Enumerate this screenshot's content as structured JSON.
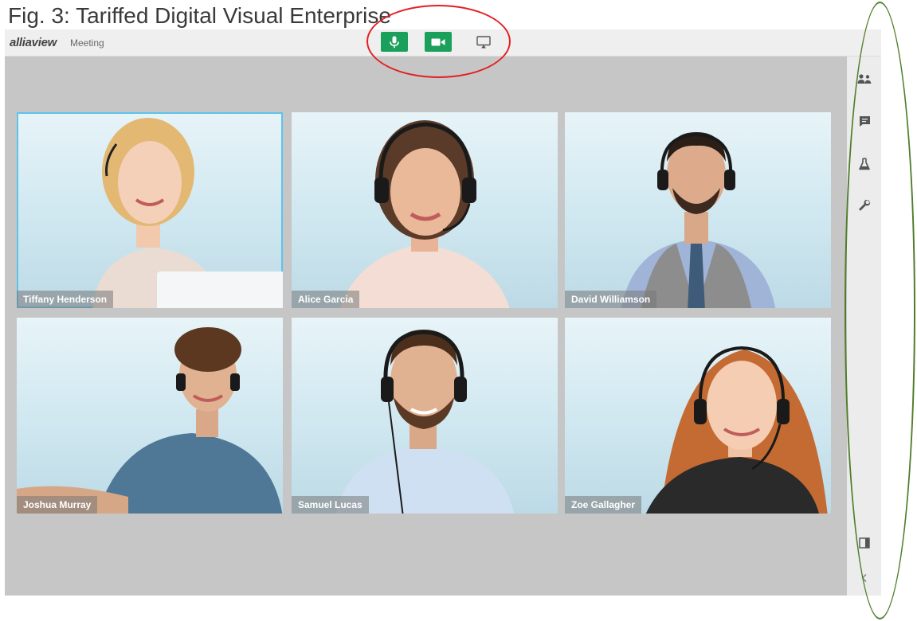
{
  "caption": "Fig. 3: Tariffed Digital Visual Enterprise",
  "app": {
    "brand": "alliaview",
    "subtitle": "Meeting"
  },
  "toolbar": {
    "buttons": [
      {
        "icon": "microphone-icon",
        "active": true
      },
      {
        "icon": "video-camera-icon",
        "active": true
      },
      {
        "icon": "screen-share-icon",
        "active": false
      }
    ]
  },
  "participants": [
    {
      "name": "Tiffany Henderson",
      "active": true
    },
    {
      "name": "Alice Garcia",
      "active": false
    },
    {
      "name": "David Williamson",
      "active": false
    },
    {
      "name": "Joshua Murray",
      "active": false
    },
    {
      "name": "Samuel Lucas",
      "active": false
    },
    {
      "name": "Zoe Gallagher",
      "active": false
    }
  ],
  "sidebar": {
    "top_icons": [
      "participants-icon",
      "chat-icon",
      "lab-flask-icon",
      "wrench-icon"
    ],
    "bottom_icons": [
      "panel-toggle-icon",
      "chevron-left-icon"
    ]
  },
  "colors": {
    "accent_green": "#1aa05a",
    "active_border": "#5dc4ec",
    "annotation_red": "#e32020",
    "annotation_green": "#4f7d2a"
  }
}
